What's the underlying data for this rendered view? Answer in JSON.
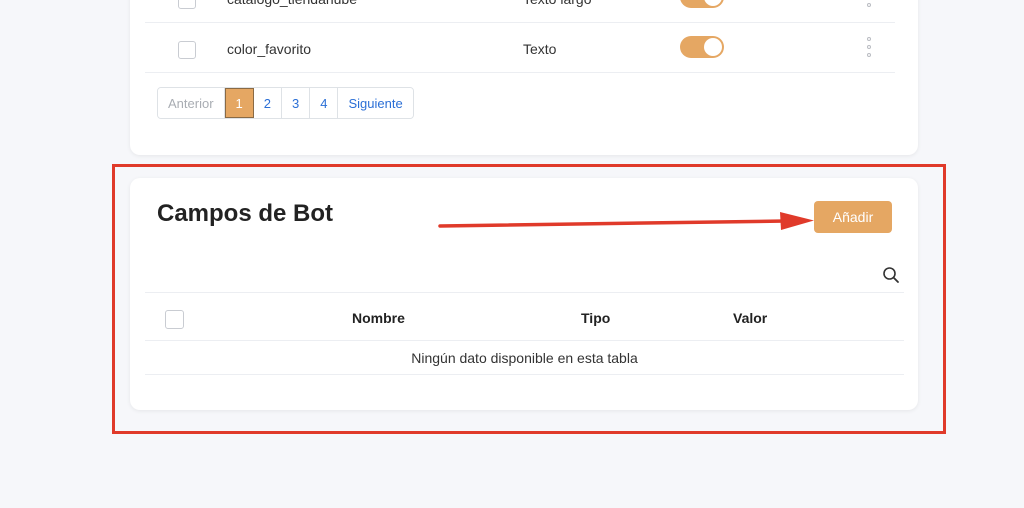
{
  "top_table": {
    "rows": [
      {
        "name": "catalogo_tiendanube",
        "type": "Texto largo"
      },
      {
        "name": "color_favorito",
        "type": "Texto"
      }
    ]
  },
  "pagination": {
    "prev": "Anterior",
    "pages": [
      "1",
      "2",
      "3",
      "4"
    ],
    "next": "Siguiente",
    "active_page": "1"
  },
  "bot_fields": {
    "title": "Campos de Bot",
    "add_label": "Añadir",
    "columns": [
      "Nombre",
      "Tipo",
      "Valor"
    ],
    "empty_message": "Ningún dato disponible en esta tabla"
  },
  "colors": {
    "accent": "#e5a763",
    "annotation": "#e03a2a",
    "link": "#2b6fd6"
  },
  "icons": [
    "checkbox-icon",
    "kebab-menu-icon",
    "search-icon",
    "arrow-annotation-icon"
  ]
}
